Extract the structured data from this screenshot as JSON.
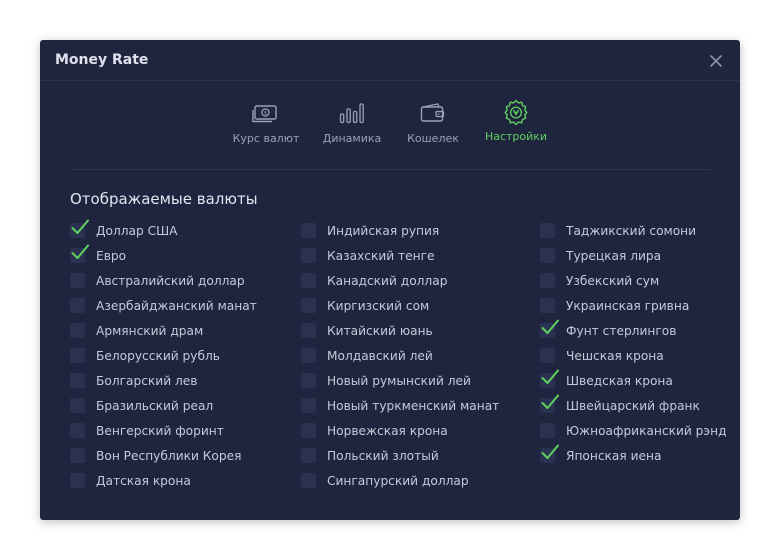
{
  "window": {
    "title": "Money Rate"
  },
  "colors": {
    "accent": "#5ed15e",
    "background": "#20253f",
    "checkbox": "#2b3150",
    "text": "#c5c9d8"
  },
  "nav": {
    "tabs": [
      {
        "label": "Курс валют",
        "icon": "banknote-icon",
        "active": false
      },
      {
        "label": "Динамика",
        "icon": "bar-chart-icon",
        "active": false
      },
      {
        "label": "Кошелек",
        "icon": "wallet-icon",
        "active": false
      },
      {
        "label": "Настройки",
        "icon": "gear-icon",
        "active": true
      }
    ]
  },
  "section": {
    "title": "Отображаемые валюты"
  },
  "currencies": {
    "col1": [
      {
        "label": "Доллар США",
        "checked": true
      },
      {
        "label": "Евро",
        "checked": true
      },
      {
        "label": "Австралийский доллар",
        "checked": false
      },
      {
        "label": "Азербайджанский манат",
        "checked": false
      },
      {
        "label": "Армянский драм",
        "checked": false
      },
      {
        "label": "Белорусский рубль",
        "checked": false
      },
      {
        "label": "Болгарский лев",
        "checked": false
      },
      {
        "label": "Бразильский реал",
        "checked": false
      },
      {
        "label": "Венгерский форинт",
        "checked": false
      },
      {
        "label": "Вон Республики Корея",
        "checked": false
      },
      {
        "label": "Датская крона",
        "checked": false
      }
    ],
    "col2": [
      {
        "label": "Индийская рупия",
        "checked": false
      },
      {
        "label": "Казахский тенге",
        "checked": false
      },
      {
        "label": "Канадский доллар",
        "checked": false
      },
      {
        "label": "Киргизский сом",
        "checked": false
      },
      {
        "label": "Китайский юань",
        "checked": false
      },
      {
        "label": "Молдавский лей",
        "checked": false
      },
      {
        "label": "Новый румынский лей",
        "checked": false
      },
      {
        "label": "Новый туркменский манат",
        "checked": false
      },
      {
        "label": "Норвежская крона",
        "checked": false
      },
      {
        "label": "Польский злотый",
        "checked": false
      },
      {
        "label": "Сингапурский доллар",
        "checked": false
      }
    ],
    "col3": [
      {
        "label": "Таджикский сомони",
        "checked": false
      },
      {
        "label": "Турецкая лира",
        "checked": false
      },
      {
        "label": "Узбекский сум",
        "checked": false
      },
      {
        "label": "Украинская гривна",
        "checked": false
      },
      {
        "label": "Фунт стерлингов",
        "checked": true
      },
      {
        "label": "Чешская крона",
        "checked": false
      },
      {
        "label": "Шведская крона",
        "checked": true
      },
      {
        "label": "Швейцарский франк",
        "checked": true
      },
      {
        "label": "Южноафриканский рэнд",
        "checked": false
      },
      {
        "label": "Японская иена",
        "checked": true
      }
    ]
  }
}
